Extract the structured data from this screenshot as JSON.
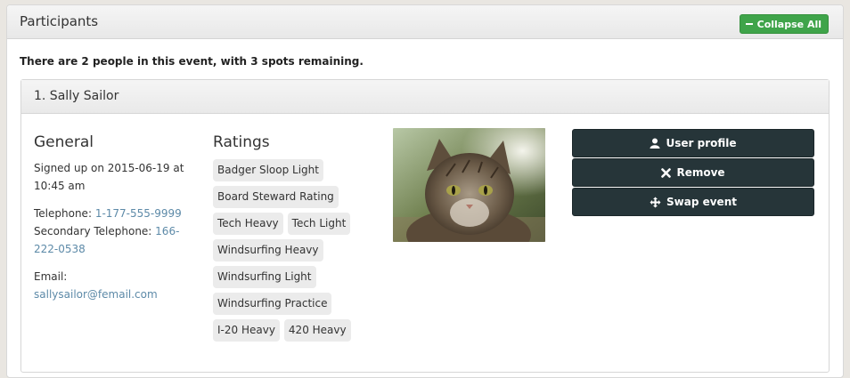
{
  "panel": {
    "title": "Participants",
    "collapse_label": "Collapse All"
  },
  "summary": "There are 2 people in this event, with 3 spots remaining.",
  "participant": {
    "heading": "1. Sally Sailor",
    "general": {
      "heading": "General",
      "signed_up_line1": "Signed up on 2015-06-19 at",
      "signed_up_line2": "10:45 am",
      "telephone_label": "Telephone: ",
      "telephone_value": "1-177-555-9999",
      "secondary_label": "Secondary Telephone: ",
      "secondary_value_part1": "166-",
      "secondary_value_part2": "222-0538",
      "email_label": "Email:",
      "email_value": "sallysailor@femail.com"
    },
    "ratings": {
      "heading": "Ratings",
      "tags": [
        "Badger Sloop Light",
        "Board Steward Rating",
        "Tech Heavy",
        "Tech Light",
        "Windsurfing Heavy",
        "Windsurfing Light",
        "Windsurfing Practice",
        "I-20 Heavy",
        "420 Heavy"
      ]
    },
    "photo_icon": "cat-photo",
    "actions": {
      "user_profile": "User profile",
      "remove": "Remove",
      "swap_event": "Swap event"
    }
  },
  "colors": {
    "collapse_button": "#3fa44a",
    "action_button": "#263539",
    "link": "#5d8aa8"
  }
}
